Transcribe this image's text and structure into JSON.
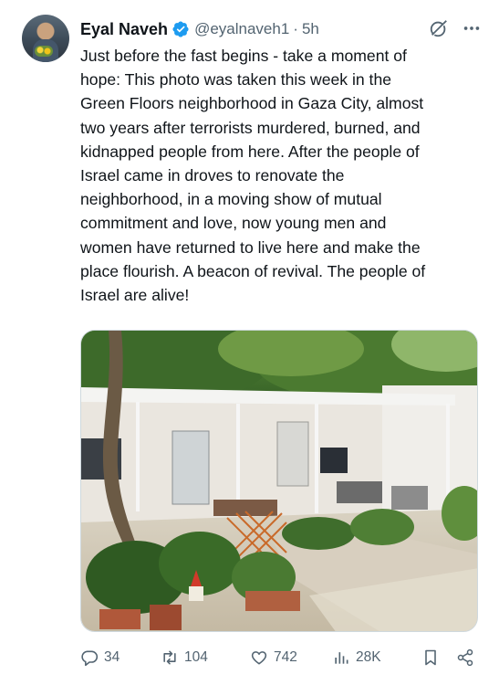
{
  "author": {
    "name": "Eyal Naveh",
    "handle": "@eyalnaveh1",
    "separator": "·",
    "time": "5h"
  },
  "tweet": {
    "text": "Just before the fast begins - take a moment of\nhope: This photo was taken this week in the\nGreen Floors neighborhood in Gaza City, almost\ntwo years after terrorists murdered, burned, and\nkidnapped people from here. After the people of\nIsrael came in droves to renovate the\nneighborhood, in a moving show of mutual\ncommitment and love, now young men and\nwomen have returned to live here and make the\nplace flourish. A beacon of revival. The people of\nIsrael are alive!"
  },
  "stats": {
    "replies": "34",
    "reposts": "104",
    "likes": "742",
    "views": "28K"
  },
  "icons": {
    "verified": "verified-badge-icon",
    "grok": "grok-icon",
    "more": "more-icon",
    "reply": "reply-icon",
    "repost": "repost-icon",
    "like": "heart-icon",
    "views": "views-icon",
    "bookmark": "bookmark-icon",
    "share": "share-icon"
  },
  "colors": {
    "text": "#0f1419",
    "secondary": "#536471",
    "verified": "#1d9bf0"
  }
}
